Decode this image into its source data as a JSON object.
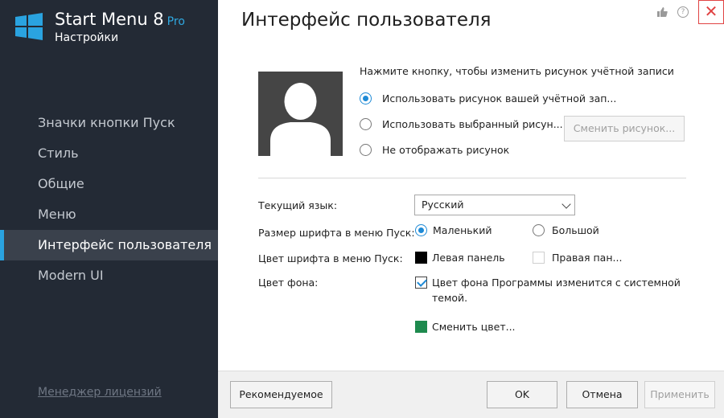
{
  "app": {
    "title": "Start Menu 8",
    "edition": "Pro",
    "subtitle": "Настройки"
  },
  "sidebar": {
    "items": [
      {
        "label": "Значки кнопки Пуск"
      },
      {
        "label": "Стиль"
      },
      {
        "label": "Общие"
      },
      {
        "label": "Меню"
      },
      {
        "label": "Интерфейс пользователя",
        "active": true
      },
      {
        "label": "Modern UI"
      }
    ],
    "license_link": "Менеджер лицензий"
  },
  "header": {
    "title": "Интерфейс пользователя",
    "icons": [
      "thumbs-up-icon",
      "help-icon",
      "close-icon"
    ],
    "close_label": "✕"
  },
  "account_picture": {
    "hint": "Нажмите кнопку, чтобы изменить рисунок учётной записи",
    "options": [
      {
        "label": "Использовать рисунок вашей учётной зап...",
        "checked": true
      },
      {
        "label": "Использовать выбранный рисун...",
        "checked": false
      },
      {
        "label": "Не отображать рисунок",
        "checked": false
      }
    ],
    "change_button": "Сменить рисунок...",
    "change_button_enabled": false
  },
  "settings": {
    "language_label": "Текущий язык:",
    "language_value": "Русский",
    "font_size_label": "Размер шрифта в меню Пуск:",
    "font_size_options": [
      {
        "label": "Маленький",
        "checked": true
      },
      {
        "label": "Большой",
        "checked": false
      }
    ],
    "font_color_label": "Цвет шрифта в меню Пуск:",
    "font_color_options": [
      {
        "label": "Левая панель",
        "color": "#000000"
      },
      {
        "label": "Правая пан...",
        "color": "#ffffff"
      }
    ],
    "bg_color_label": "Цвет фона:",
    "bg_follow_system_label": "Цвет фона Программы изменится с системной темой.",
    "bg_follow_system_checked": true,
    "change_color_label": "Сменить цвет...",
    "change_color_swatch": "#1e8a4e"
  },
  "footer": {
    "recommended": "Рекомендуемое",
    "ok": "OK",
    "cancel": "Отмена",
    "apply": "Применить",
    "apply_enabled": false
  },
  "colors": {
    "sidebar_bg": "#232a35",
    "accent": "#2aa3e0",
    "close_red": "#e04343"
  }
}
